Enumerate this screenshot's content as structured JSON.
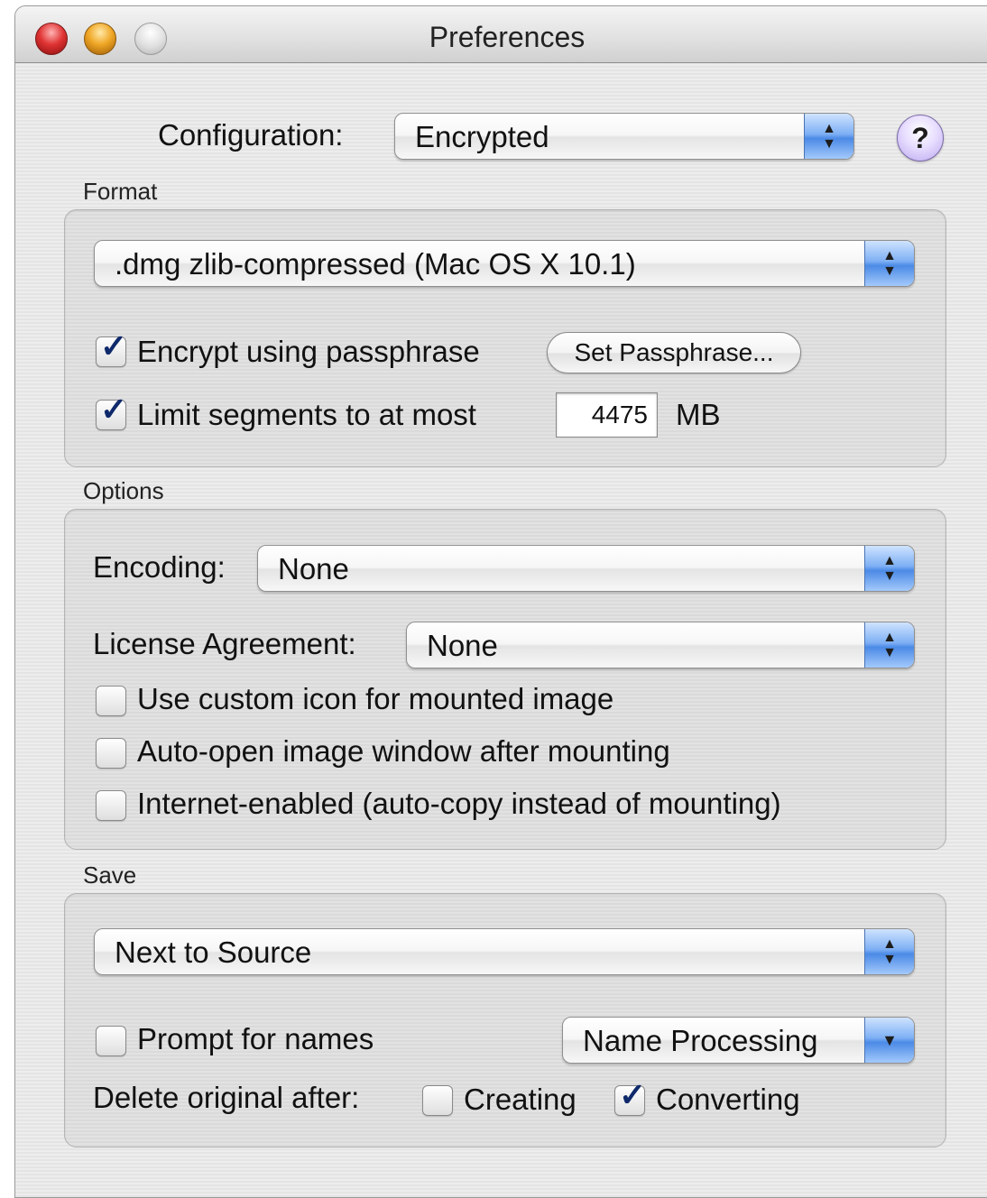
{
  "window": {
    "title": "Preferences"
  },
  "configuration": {
    "label": "Configuration:",
    "value": "Encrypted",
    "help": "?"
  },
  "format": {
    "section_label": "Format",
    "format_value": ".dmg zlib-compressed (Mac OS X 10.1)",
    "encrypt": {
      "label": "Encrypt using passphrase",
      "checked": true
    },
    "set_passphrase_label": "Set Passphrase...",
    "limit": {
      "label": "Limit segments to at most",
      "checked": true,
      "value": "4475",
      "unit": "MB"
    }
  },
  "options": {
    "section_label": "Options",
    "encoding": {
      "label": "Encoding:",
      "value": "None"
    },
    "license": {
      "label": "License Agreement:",
      "value": "None"
    },
    "custom_icon": {
      "label": "Use custom icon for mounted image",
      "checked": false
    },
    "auto_open": {
      "label": "Auto-open image window after mounting",
      "checked": false
    },
    "internet_enabled": {
      "label": "Internet-enabled (auto-copy instead of mounting)",
      "checked": false
    }
  },
  "save": {
    "section_label": "Save",
    "location": "Next to Source",
    "prompt_names": {
      "label": "Prompt for names",
      "checked": false
    },
    "name_processing": "Name Processing",
    "delete_original_label": "Delete original after:",
    "creating": {
      "label": "Creating",
      "checked": false
    },
    "converting": {
      "label": "Converting",
      "checked": true
    }
  },
  "colors": {
    "accent_blue": "#4b8ae6",
    "checkmark": "#0f2a6b",
    "help_purple": "#bba7ee"
  }
}
